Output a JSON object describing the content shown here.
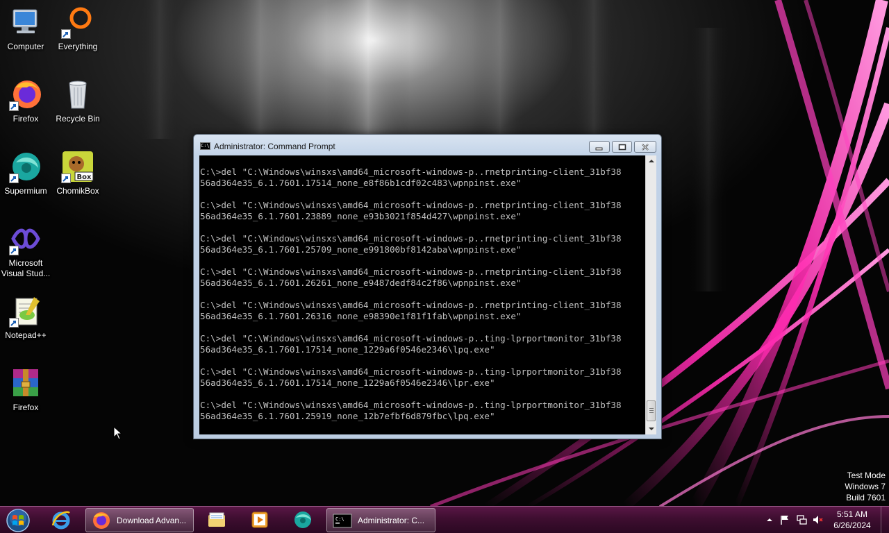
{
  "desktop": {
    "icons": [
      {
        "label": "Computer",
        "icon": "computer-icon"
      },
      {
        "label": "Everything",
        "icon": "everything-icon"
      },
      {
        "label": "Firefox",
        "icon": "firefox-icon"
      },
      {
        "label": "Recycle Bin",
        "icon": "recycle-bin-icon"
      },
      {
        "label": "Supermium",
        "icon": "supermium-icon"
      },
      {
        "label": "ChomikBox",
        "icon": "chomikbox-icon"
      },
      {
        "label": "Microsoft Visual Stud...",
        "icon": "visual-studio-icon"
      },
      {
        "label": "Notepad++",
        "icon": "notepad-plus-plus-icon"
      },
      {
        "label": "Firefox",
        "icon": "winrar-icon"
      }
    ]
  },
  "cmd_window": {
    "title": "Administrator:  Command Prompt",
    "lines": [
      "C:\\>del \"C:\\Windows\\winsxs\\amd64_microsoft-windows-p..rnetprinting-client_31bf38",
      "56ad364e35_6.1.7601.17514_none_e8f86b1cdf02c483\\wpnpinst.exe\"",
      "",
      "C:\\>del \"C:\\Windows\\winsxs\\amd64_microsoft-windows-p..rnetprinting-client_31bf38",
      "56ad364e35_6.1.7601.23889_none_e93b3021f854d427\\wpnpinst.exe\"",
      "",
      "C:\\>del \"C:\\Windows\\winsxs\\amd64_microsoft-windows-p..rnetprinting-client_31bf38",
      "56ad364e35_6.1.7601.25709_none_e991800bf8142aba\\wpnpinst.exe\"",
      "",
      "C:\\>del \"C:\\Windows\\winsxs\\amd64_microsoft-windows-p..rnetprinting-client_31bf38",
      "56ad364e35_6.1.7601.26261_none_e9487dedf84c2f86\\wpnpinst.exe\"",
      "",
      "C:\\>del \"C:\\Windows\\winsxs\\amd64_microsoft-windows-p..rnetprinting-client_31bf38",
      "56ad364e35_6.1.7601.26316_none_e98390e1f81f1fab\\wpnpinst.exe\"",
      "",
      "C:\\>del \"C:\\Windows\\winsxs\\amd64_microsoft-windows-p..ting-lprportmonitor_31bf38",
      "56ad364e35_6.1.7601.17514_none_1229a6f0546e2346\\lpq.exe\"",
      "",
      "C:\\>del \"C:\\Windows\\winsxs\\amd64_microsoft-windows-p..ting-lprportmonitor_31bf38",
      "56ad364e35_6.1.7601.17514_none_1229a6f0546e2346\\lpr.exe\"",
      "",
      "C:\\>del \"C:\\Windows\\winsxs\\amd64_microsoft-windows-p..ting-lprportmonitor_31bf38",
      "56ad364e35_6.1.7601.25919_none_12b7efbf6d879fbc\\lpq.exe\""
    ]
  },
  "watermark": {
    "line1": "Test Mode",
    "line2": "Windows 7",
    "line3": "Build 7601"
  },
  "taskbar": {
    "start_icon": "windows-start-orb-icon",
    "pinned": [
      {
        "icon": "internet-explorer-icon"
      },
      {
        "icon": "firefox-icon",
        "label": "Download Advan..."
      },
      {
        "icon": "file-explorer-icon"
      },
      {
        "icon": "media-player-icon"
      },
      {
        "icon": "supermium-icon"
      },
      {
        "icon": "command-prompt-icon",
        "label": "Administrator:  C..."
      }
    ],
    "tray": {
      "icons": [
        "show-hidden-icons-chevron",
        "action-center-flag-icon",
        "network-icon",
        "volume-muted-icon"
      ],
      "time": "5:51 AM",
      "date": "6/26/2024"
    }
  },
  "colors": {
    "wallpaper_accent": "#ff1aa8",
    "taskbar": "#3e0e30",
    "console_bg": "#000000",
    "console_text": "#c0c0c0"
  }
}
